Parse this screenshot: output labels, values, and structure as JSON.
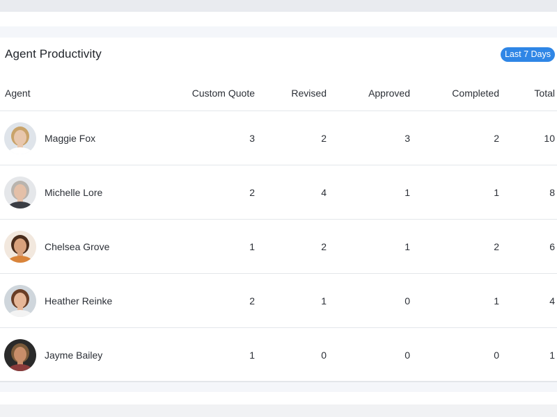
{
  "card": {
    "title": "Agent Productivity",
    "range_label": "Last 7 Days"
  },
  "table": {
    "columns": [
      "Agent",
      "Custom Quote",
      "Revised",
      "Approved",
      "Completed",
      "Total"
    ],
    "rows": [
      {
        "name": "Maggie Fox",
        "custom_quote": "3",
        "revised": "2",
        "approved": "3",
        "completed": "2",
        "total": "10",
        "avatar": {
          "skin": "#e8c7ad",
          "hair": "#c9a36a",
          "bg": "#dfe4ea",
          "shirt": "#ffffff"
        }
      },
      {
        "name": "Michelle Lore",
        "custom_quote": "2",
        "revised": "4",
        "approved": "1",
        "completed": "1",
        "total": "8",
        "avatar": {
          "skin": "#e4c0a8",
          "hair": "#b9b4ae",
          "bg": "#e5e7ea",
          "shirt": "#3a3d44"
        }
      },
      {
        "name": "Chelsea Grove",
        "custom_quote": "1",
        "revised": "2",
        "approved": "1",
        "completed": "2",
        "total": "6",
        "avatar": {
          "skin": "#d9a27d",
          "hair": "#4a2d1c",
          "bg": "#f2e8de",
          "shirt": "#d9843a"
        }
      },
      {
        "name": "Heather Reinke",
        "custom_quote": "2",
        "revised": "1",
        "approved": "0",
        "completed": "1",
        "total": "4",
        "avatar": {
          "skin": "#e6b798",
          "hair": "#6a3e26",
          "bg": "#cfd6dc",
          "shirt": "#f3f3f3"
        }
      },
      {
        "name": "Jayme Bailey",
        "custom_quote": "1",
        "revised": "0",
        "approved": "0",
        "completed": "0",
        "total": "1",
        "avatar": {
          "skin": "#c98e6a",
          "hair": "#7a5a3a",
          "bg": "#2a2a2a",
          "shirt": "#8a3b3b"
        }
      }
    ]
  },
  "colors": {
    "accent": "#2f86e6",
    "divider": "#e3e6ea",
    "text": "#2b2f36"
  }
}
